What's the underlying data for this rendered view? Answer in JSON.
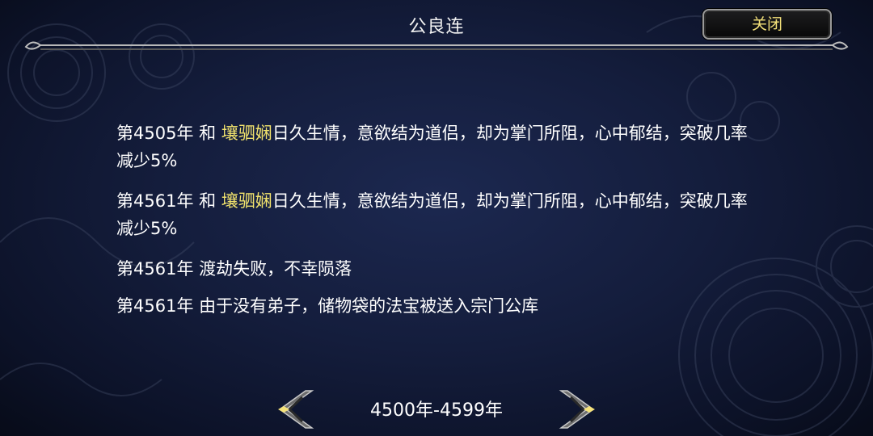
{
  "header": {
    "title": "公良连",
    "close_label": "关闭"
  },
  "log": [
    {
      "prefix": "第4505年 和 ",
      "name": "壤驷娴",
      "suffix": "日久生情，意欲结为道侣，却为掌门所阻，心中郁结，突破几率减少5%"
    },
    {
      "prefix": "第4561年 和 ",
      "name": "壤驷娴",
      "suffix": "日久生情，意欲结为道侣，却为掌门所阻，心中郁结，突破几率减少5%"
    },
    {
      "prefix": "第4561年 渡劫失败，不幸陨落",
      "name": "",
      "suffix": ""
    },
    {
      "prefix": "第4561年 由于没有弟子，储物袋的法宝被送入宗门公库",
      "name": "",
      "suffix": ""
    }
  ],
  "pager": {
    "range_label": "4500年-4599年",
    "prev_icon": "left-arrow-icon",
    "next_icon": "right-arrow-icon"
  },
  "colors": {
    "highlight": "#f3e46d",
    "close_text": "#f5e27a",
    "background": "#141d3c"
  }
}
